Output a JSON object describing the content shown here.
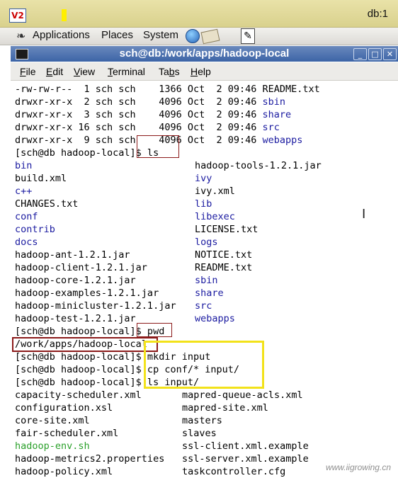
{
  "vnc": {
    "logo": "V2",
    "title": "db:1"
  },
  "panel": {
    "applications": "Applications",
    "places": "Places",
    "system": "System"
  },
  "window": {
    "title": "sch@db:/work/apps/hadoop-local",
    "buttons": {
      "minimize": "_",
      "maximize": "□",
      "close": "✕"
    }
  },
  "menubar": [
    {
      "key": "F",
      "rest": "ile"
    },
    {
      "key": "E",
      "rest": "dit"
    },
    {
      "key": "V",
      "rest": "iew"
    },
    {
      "key": "T",
      "rest": "erminal"
    },
    {
      "pre": "Ta",
      "key": "b",
      "rest": "s"
    },
    {
      "key": "H",
      "rest": "elp"
    }
  ],
  "terminal": {
    "listing": [
      {
        "perms": "-rw-rw-r--",
        "links": "1",
        "user": "sch",
        "group": "sch",
        "size": "1366",
        "month": "Oct",
        "day": "2",
        "time": "09:46",
        "name": "README.txt",
        "dir": false
      },
      {
        "perms": "drwxr-xr-x",
        "links": "2",
        "user": "sch",
        "group": "sch",
        "size": "4096",
        "month": "Oct",
        "day": "2",
        "time": "09:46",
        "name": "sbin",
        "dir": true
      },
      {
        "perms": "drwxr-xr-x",
        "links": "3",
        "user": "sch",
        "group": "sch",
        "size": "4096",
        "month": "Oct",
        "day": "2",
        "time": "09:46",
        "name": "share",
        "dir": true
      },
      {
        "perms": "drwxr-xr-x",
        "links": "16",
        "user": "sch",
        "group": "sch",
        "size": "4096",
        "month": "Oct",
        "day": "2",
        "time": "09:46",
        "name": "src",
        "dir": true
      },
      {
        "perms": "drwxr-xr-x",
        "links": "9",
        "user": "sch",
        "group": "sch",
        "size": "4096",
        "month": "Oct",
        "day": "2",
        "time": "09:46",
        "name": "webapps",
        "dir": true
      }
    ],
    "cmd_ls": "[sch@db hadoop-local]$ ls",
    "ls_col1": [
      {
        "name": "bin",
        "dir": true
      },
      {
        "name": "build.xml",
        "dir": false
      },
      {
        "name": "c++",
        "dir": true
      },
      {
        "name": "CHANGES.txt",
        "dir": false
      },
      {
        "name": "conf",
        "dir": true
      },
      {
        "name": "contrib",
        "dir": true
      },
      {
        "name": "docs",
        "dir": true
      },
      {
        "name": "hadoop-ant-1.2.1.jar",
        "dir": false
      },
      {
        "name": "hadoop-client-1.2.1.jar",
        "dir": false
      },
      {
        "name": "hadoop-core-1.2.1.jar",
        "dir": false
      },
      {
        "name": "hadoop-examples-1.2.1.jar",
        "dir": false
      },
      {
        "name": "hadoop-minicluster-1.2.1.jar",
        "dir": false
      },
      {
        "name": "hadoop-test-1.2.1.jar",
        "dir": false
      }
    ],
    "ls_col2": [
      {
        "name": "hadoop-tools-1.2.1.jar",
        "dir": false
      },
      {
        "name": "ivy",
        "dir": true
      },
      {
        "name": "ivy.xml",
        "dir": false
      },
      {
        "name": "lib",
        "dir": true
      },
      {
        "name": "libexec",
        "dir": true
      },
      {
        "name": "LICENSE.txt",
        "dir": false
      },
      {
        "name": "logs",
        "dir": true
      },
      {
        "name": "NOTICE.txt",
        "dir": false
      },
      {
        "name": "README.txt",
        "dir": false
      },
      {
        "name": "sbin",
        "dir": true
      },
      {
        "name": "share",
        "dir": true
      },
      {
        "name": "src",
        "dir": true
      },
      {
        "name": "webapps",
        "dir": true
      }
    ],
    "cmd_pwd": "[sch@db hadoop-local]$ pwd",
    "pwd_output": "/work/apps/hadoop-local",
    "cmd_mkdir": "[sch@db hadoop-local]$ mkdir input",
    "cmd_cp": "[sch@db hadoop-local]$ cp conf/* input/",
    "cmd_ls_input": "[sch@db hadoop-local]$ ls input/",
    "input_col1": [
      {
        "name": "capacity-scheduler.xml",
        "exe": false
      },
      {
        "name": "configuration.xsl",
        "exe": false
      },
      {
        "name": "core-site.xml",
        "exe": false
      },
      {
        "name": "fair-scheduler.xml",
        "exe": false
      },
      {
        "name": "hadoop-env.sh",
        "exe": true
      },
      {
        "name": "hadoop-metrics2.properties",
        "exe": false
      },
      {
        "name": "hadoop-policy.xml",
        "exe": false
      }
    ],
    "input_col2": [
      {
        "name": "mapred-queue-acls.xml",
        "exe": false
      },
      {
        "name": "mapred-site.xml",
        "exe": false
      },
      {
        "name": "masters",
        "exe": false
      },
      {
        "name": "slaves",
        "exe": false
      },
      {
        "name": "ssl-client.xml.example",
        "exe": false
      },
      {
        "name": "ssl-server.xml.example",
        "exe": false
      },
      {
        "name": "taskcontroller.cfg",
        "exe": false
      }
    ]
  },
  "colors": {
    "dir": "#1a1aa0",
    "exe": "#2aa02a",
    "highlight_red": "#8b1a1a",
    "highlight_yellow": "#f2e21a"
  },
  "watermark": "www.iigrowing.cn"
}
